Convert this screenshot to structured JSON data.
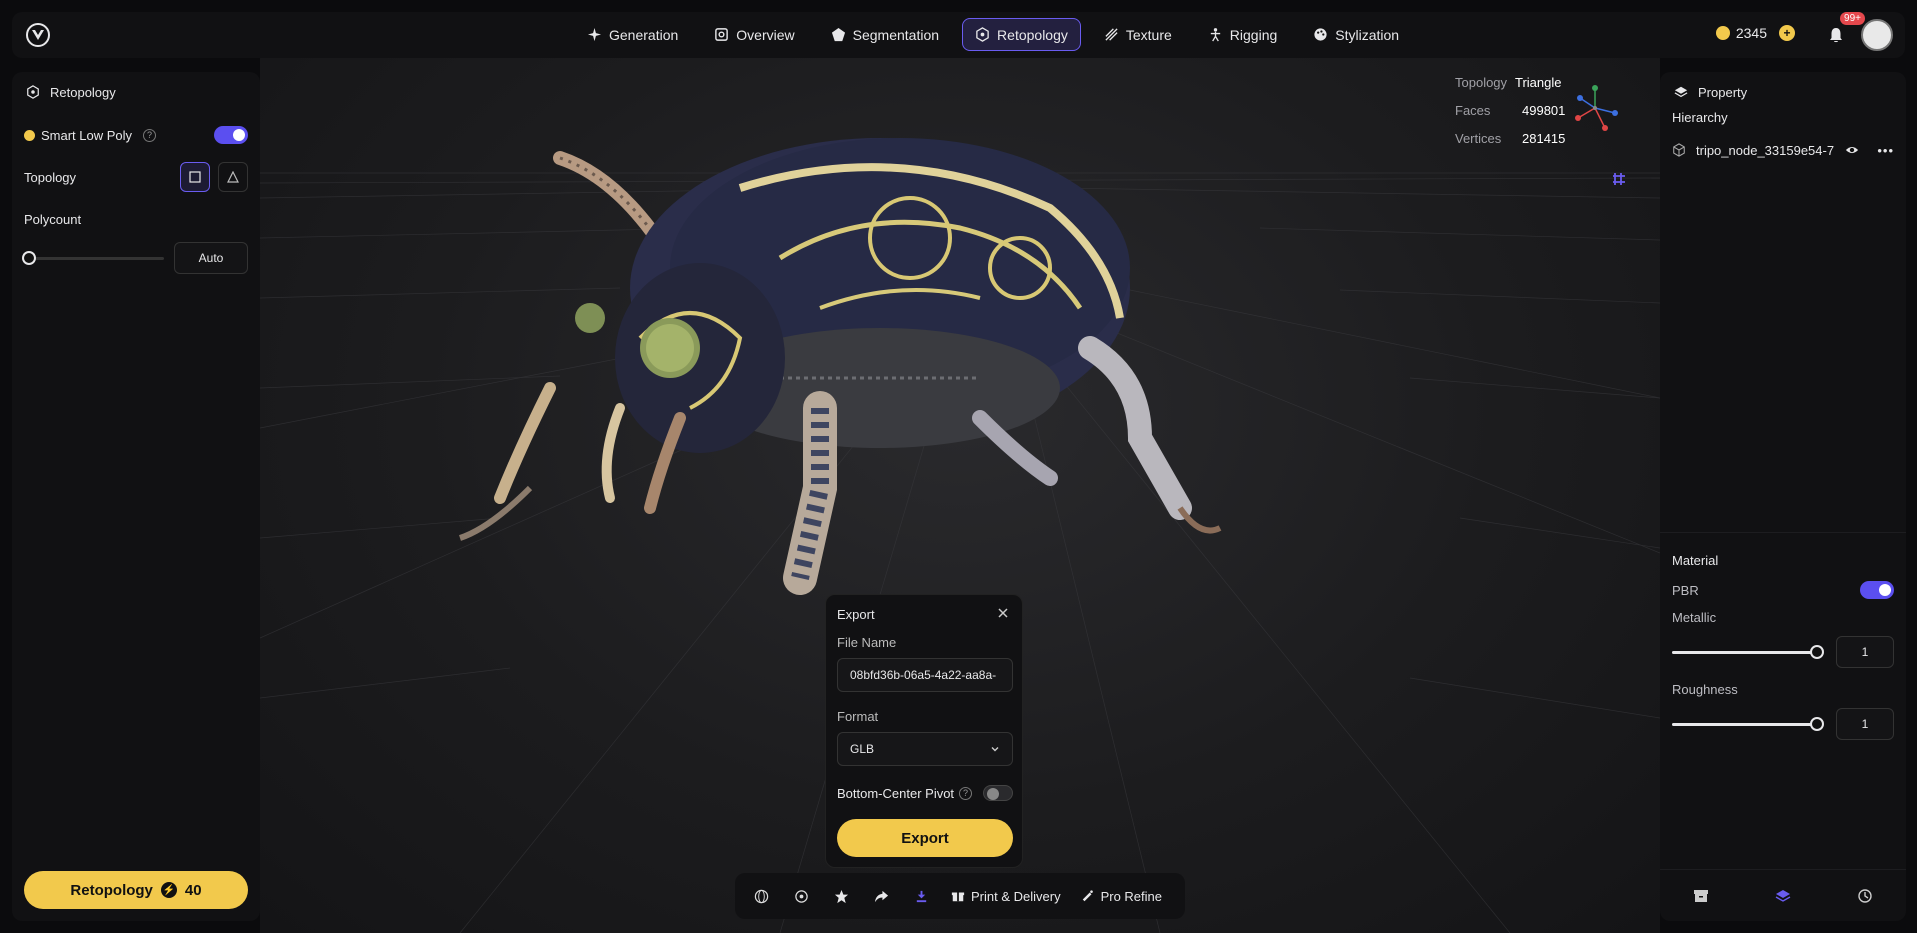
{
  "nav": {
    "items": [
      {
        "label": "Generation",
        "icon": "sparkle-icon"
      },
      {
        "label": "Overview",
        "icon": "scan-icon"
      },
      {
        "label": "Segmentation",
        "icon": "segment-icon"
      },
      {
        "label": "Retopology",
        "icon": "retopology-icon",
        "active": true
      },
      {
        "label": "Texture",
        "icon": "texture-icon"
      },
      {
        "label": "Rigging",
        "icon": "rigging-icon"
      },
      {
        "label": "Stylization",
        "icon": "palette-icon"
      }
    ],
    "credits": "2345",
    "notifications_badge": "99+"
  },
  "left_panel": {
    "title": "Retopology",
    "smart_low_poly_label": "Smart Low Poly",
    "smart_low_poly_on": true,
    "topology_label": "Topology",
    "polycount_label": "Polycount",
    "polycount_value": "Auto",
    "action_label": "Retopology",
    "action_cost": "40"
  },
  "stats": {
    "topology_label": "Topology",
    "topology_value": "Triangle",
    "faces_label": "Faces",
    "faces_value": "499801",
    "vertices_label": "Vertices",
    "vertices_value": "281415"
  },
  "export": {
    "title": "Export",
    "file_name_label": "File Name",
    "file_name_value": "08bfd36b-06a5-4a22-aa8a-",
    "format_label": "Format",
    "format_value": "GLB",
    "pivot_label": "Bottom-Center Pivot",
    "pivot_on": false,
    "button_label": "Export"
  },
  "bottombar": {
    "print_label": "Print & Delivery",
    "refine_label": "Pro Refine"
  },
  "right_panel": {
    "title": "Property",
    "hierarchy_label": "Hierarchy",
    "node_name": "tripo_node_33159e54-7...",
    "material_label": "Material",
    "pbr_label": "PBR",
    "pbr_on": true,
    "metallic_label": "Metallic",
    "metallic_value": "1",
    "roughness_label": "Roughness",
    "roughness_value": "1"
  },
  "colors": {
    "accent": "#5b4ff0",
    "brand_yellow": "#f2c94c"
  }
}
